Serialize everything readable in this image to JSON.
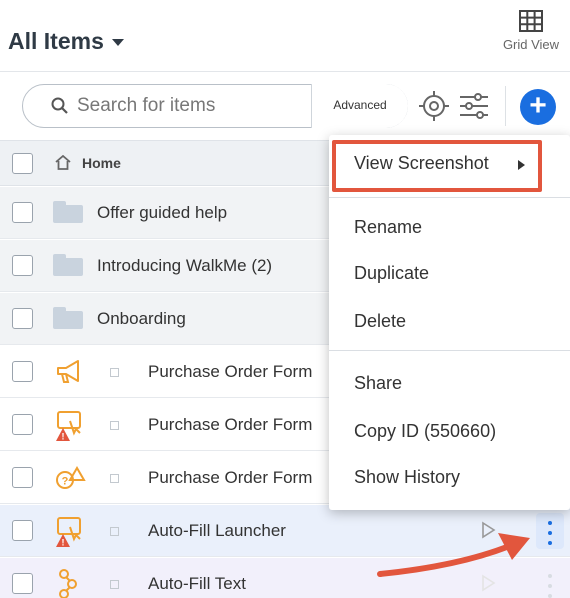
{
  "header": {
    "title": "All Items",
    "grid_view_label": "Grid View"
  },
  "toolbar": {
    "search_placeholder": "Search for items",
    "advanced_label": "Advanced"
  },
  "breadcrumb": {
    "home_label": "Home"
  },
  "folders": [
    {
      "label": "Offer guided help"
    },
    {
      "label": "Introducing WalkMe (2)"
    },
    {
      "label": "Onboarding"
    }
  ],
  "items": [
    {
      "label": "Purchase Order Form",
      "icon": "megaphone-icon"
    },
    {
      "label": "Purchase Order Form",
      "icon": "launcher-warning-icon"
    },
    {
      "label": "Purchase Order Form",
      "icon": "smarttip-warning-icon"
    },
    {
      "label": "Auto-Fill Launcher",
      "icon": "launcher-warning-icon"
    },
    {
      "label": "Auto-Fill Text",
      "icon": "flow-icon"
    }
  ],
  "context_menu": {
    "items": [
      {
        "label": "View Screenshot",
        "has_submenu": true
      },
      {
        "label": "Rename"
      },
      {
        "label": "Duplicate"
      },
      {
        "label": "Delete"
      },
      {
        "label": "Share"
      },
      {
        "label": "Copy ID (550660)"
      },
      {
        "label": "Show History"
      }
    ]
  },
  "colors": {
    "accent": "#1a6ee0",
    "annotation": "#e2563d",
    "icon_orange": "#f0a030"
  }
}
